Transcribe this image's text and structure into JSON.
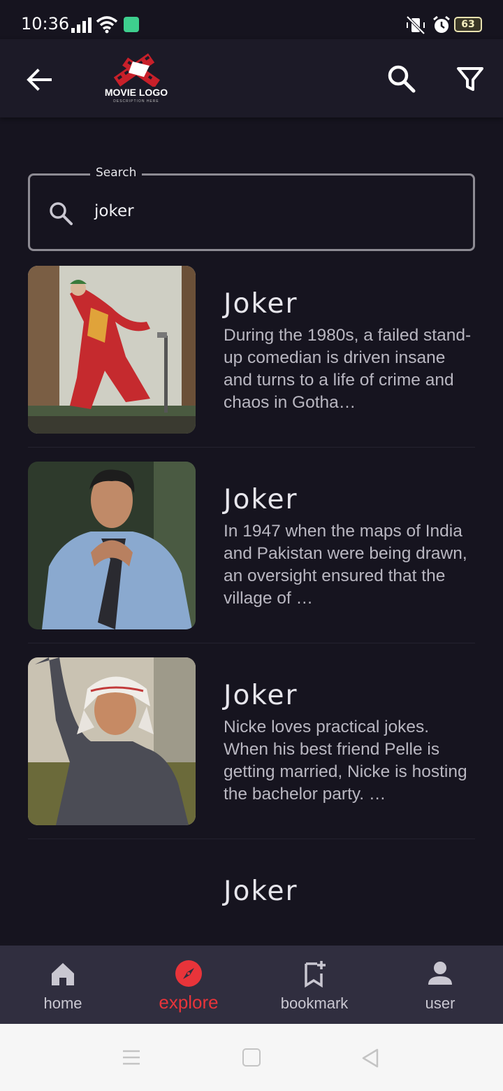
{
  "status_bar": {
    "time": "10:36",
    "battery": "63"
  },
  "app_bar": {
    "logo_title": "MOVIE LOGO",
    "logo_subtitle": "DESCRIPTION HERE",
    "icons": [
      "back-arrow-icon",
      "search-icon",
      "filter-icon"
    ]
  },
  "search": {
    "label": "Search",
    "value": "joker"
  },
  "results": [
    {
      "title": "Joker",
      "description": "During the 1980s, a failed stand-up comedian is driven insane and turns to a life of crime and chaos in Gotha…"
    },
    {
      "title": "Joker",
      "description": "In 1947 when the maps of India and Pakistan were being drawn, an oversight ensured that the village of …"
    },
    {
      "title": "Joker",
      "description": "Nicke loves practical jokes. When his best friend Pelle is getting married, Nicke is hosting the bachelor party. …"
    },
    {
      "title": "Joker",
      "description": ""
    }
  ],
  "bottom_nav": {
    "items": [
      {
        "label": "home",
        "icon": "home-icon"
      },
      {
        "label": "explore",
        "icon": "compass-icon"
      },
      {
        "label": "bookmark",
        "icon": "bookmark-add-icon"
      },
      {
        "label": "user",
        "icon": "user-icon"
      }
    ],
    "active": "explore",
    "active_color": "#e8343a"
  }
}
